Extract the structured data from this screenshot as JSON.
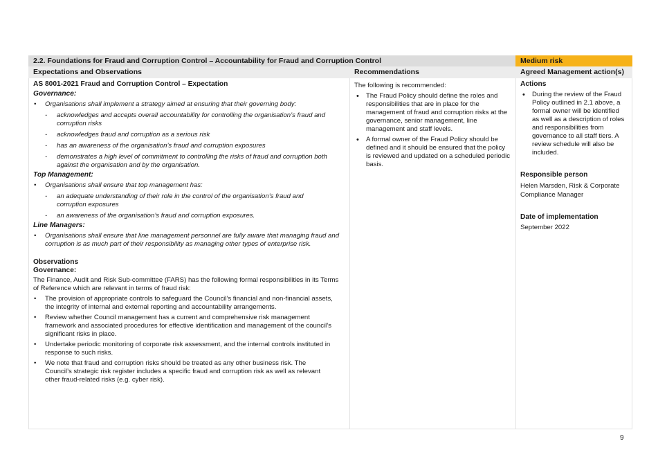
{
  "header": {
    "section_title": "2.2. Foundations for Fraud and Corruption Control – Accountability for Fraud and Corruption Control",
    "risk_label": "Medium risk",
    "risk_color": "#f6b21a"
  },
  "columns": {
    "observations": "Expectations and Observations",
    "recommendations": "Recommendations",
    "actions": "Agreed Management action(s)"
  },
  "expectations": {
    "heading": "AS 8001-2021 Fraud and Corruption Control – Expectation",
    "governance_label": "Governance:",
    "governance_intro": "Organisations shall implement a strategy aimed at ensuring that their governing body:",
    "governance_items": [
      "acknowledges and accepts overall accountability for controlling the organisation’s fraud and corruption risks",
      "acknowledges fraud and corruption as a serious risk",
      "has an awareness of the organisation’s fraud and corruption exposures",
      "demonstrates a high level of commitment to controlling the risks of fraud and corruption both against the organisation and by the organisation."
    ],
    "top_mgmt_label": "Top Management:",
    "top_mgmt_intro": "Organisations shall ensure that top management has:",
    "top_mgmt_items": [
      "an adequate understanding of their role in the control of the organisation’s fraud and corruption exposures",
      "an awareness of the organisation’s fraud and corruption exposures."
    ],
    "line_mgr_label": "Line Managers:",
    "line_mgr_text": "Organisations shall ensure that line management personnel are fully aware that managing fraud and corruption is as much part of their responsibility as managing other types of enterprise risk."
  },
  "observations": {
    "heading": "Observations",
    "governance_label": "Governance:",
    "intro": "The Finance, Audit and Risk Sub-committee (FARS) has the following formal responsibilities in its Terms of Reference which are relevant in terms of fraud risk:",
    "items": [
      "The provision of appropriate controls to safeguard the Council’s financial and non-financial assets, the integrity of internal and external reporting and accountability arrangements.",
      "Review whether Council management has a current and comprehensive risk management framework and associated procedures for effective identification and management of the council’s significant risks in place.",
      "Undertake periodic monitoring of corporate risk assessment, and the internal controls instituted in response to such risks.",
      "We note that fraud and corruption risks should be treated as any other business risk. The Council’s strategic risk register includes a specific fraud and corruption risk as well as relevant other fraud-related risks (e.g. cyber risk)."
    ]
  },
  "recommendations": {
    "intro": "The following is recommended:",
    "items": [
      "The Fraud Policy should define the roles and responsibilities that are in place for the management of fraud and corruption risks at the governance, senior management, line management and staff levels.",
      "A formal owner of the Fraud Policy should be defined and it should be ensured that the policy is reviewed and updated on a scheduled periodic basis."
    ]
  },
  "actions": {
    "label": "Actions",
    "items": [
      "During the review of the Fraud Policy outlined in 2.1 above, a formal owner will be identified as well as a description of roles and responsibilities from governance to all staff tiers. A review schedule will also be included."
    ],
    "responsible_label": "Responsible person",
    "responsible_value": "Helen Marsden, Risk & Corporate Compliance Manager",
    "date_label": "Date of implementation",
    "date_value": "September 2022"
  },
  "page_number": "9"
}
